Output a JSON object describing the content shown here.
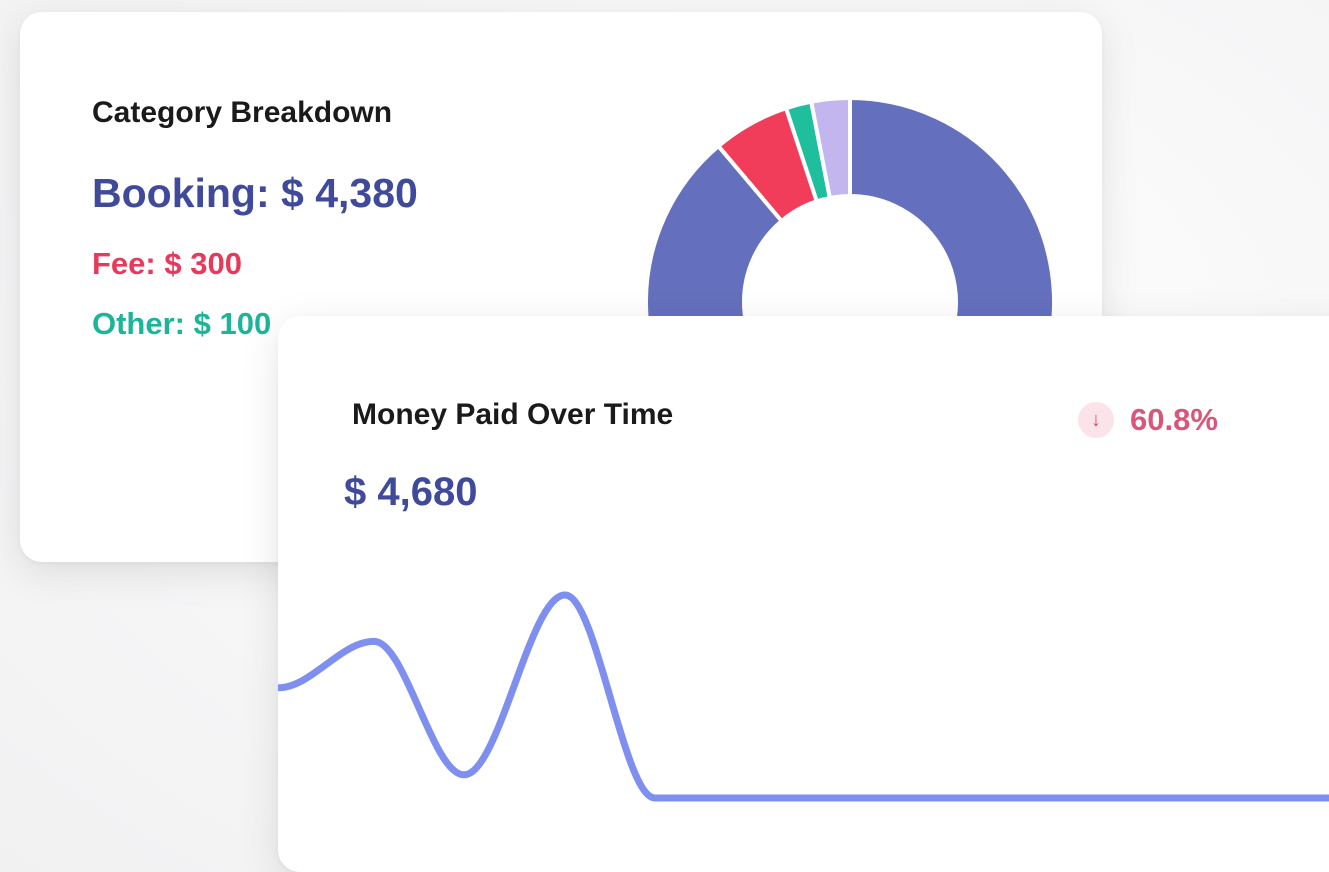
{
  "category_breakdown": {
    "title": "Category Breakdown",
    "booking_text": "Booking: $ 4,380",
    "fee_text": "Fee: $ 300",
    "other_text": "Other: $ 100",
    "colors": {
      "booking": "#6470bd",
      "fee": "#f23d5a",
      "other": "#1fbf9e",
      "extra": "#c3b6ef"
    },
    "slices": [
      {
        "name": "Booking",
        "value": 4380,
        "color": "#6470bd"
      },
      {
        "name": "Fee",
        "value": 300,
        "color": "#f23d5a"
      },
      {
        "name": "Other",
        "value": 100,
        "color": "#1fbf9e"
      },
      {
        "name": "",
        "value": 150,
        "color": "#c3b6ef"
      }
    ]
  },
  "money_paid": {
    "title": "Money Paid Over Time",
    "total": "$ 4,680",
    "trend_icon": "arrow-down-icon",
    "trend_symbol": "↓",
    "trend_value": "60.8%",
    "line_color": "#7f8ff0"
  },
  "chart_data": [
    {
      "type": "pie",
      "title": "Category Breakdown",
      "categories": [
        "Booking",
        "Fee",
        "Other",
        ""
      ],
      "values": [
        4380,
        300,
        100,
        150
      ],
      "colors": [
        "#6470bd",
        "#f23d5a",
        "#1fbf9e",
        "#c3b6ef"
      ]
    },
    {
      "type": "line",
      "title": "Money Paid Over Time",
      "xlabel": "",
      "ylabel": "",
      "x": [
        0,
        1,
        2,
        3,
        4,
        5,
        6
      ],
      "series": [
        {
          "values": [
            1900,
            2700,
            400,
            3500,
            0,
            0,
            0
          ]
        }
      ],
      "ylim": [
        0,
        4000
      ],
      "grid": false
    }
  ]
}
